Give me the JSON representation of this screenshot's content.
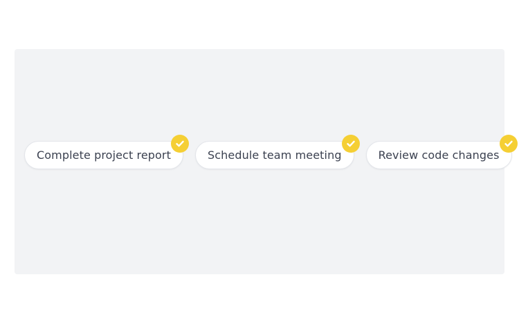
{
  "colors": {
    "accent": "#f5cf34",
    "panel_bg": "#f2f3f5",
    "chip_text": "#3b4150"
  },
  "chips": [
    {
      "label": "Complete project report",
      "selected": true,
      "icon": "check-icon"
    },
    {
      "label": "Schedule team meeting",
      "selected": true,
      "icon": "check-icon"
    },
    {
      "label": "Review code changes",
      "selected": true,
      "icon": "check-icon"
    }
  ]
}
